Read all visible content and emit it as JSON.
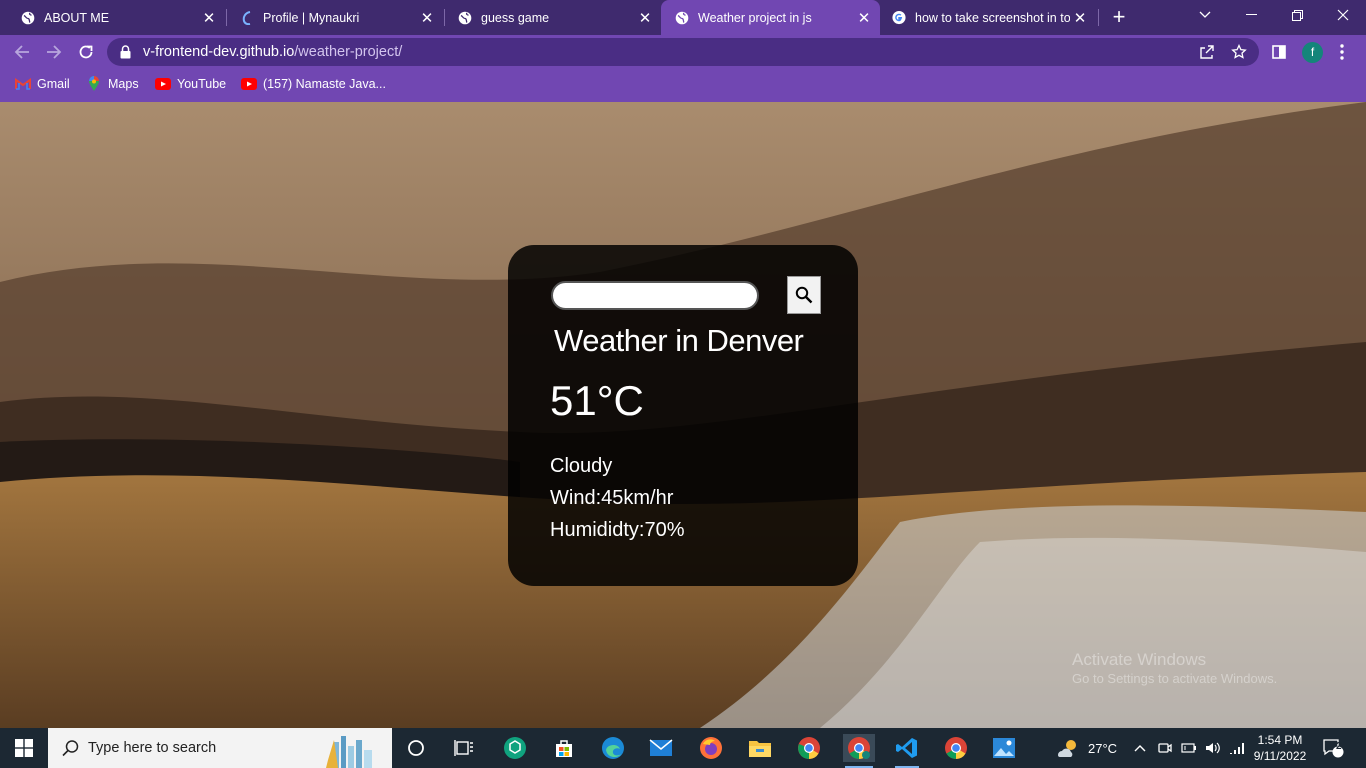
{
  "tabs": [
    {
      "title": "ABOUT ME",
      "icon": "globe-icon",
      "active": false
    },
    {
      "title": "Profile | Mynaukri",
      "icon": "naukri-icon",
      "active": false
    },
    {
      "title": "guess game",
      "icon": "globe-icon",
      "active": false
    },
    {
      "title": "Weather project in js",
      "icon": "globe-icon",
      "active": true
    },
    {
      "title": "how to take screenshot in to",
      "icon": "google-icon",
      "active": false
    }
  ],
  "address_bar": {
    "host": "v-frontend-dev.github.io",
    "path": "/weather-project/"
  },
  "profile_initial": "f",
  "bookmarks": [
    {
      "label": "Gmail",
      "icon": "gmail-icon"
    },
    {
      "label": "Maps",
      "icon": "maps-icon"
    },
    {
      "label": "YouTube",
      "icon": "youtube-icon"
    },
    {
      "label": "(157) Namaste Java...",
      "icon": "youtube-icon"
    }
  ],
  "weather": {
    "search_value": "",
    "city": "Weather in Denver",
    "temperature": "51°C",
    "description": "Cloudy",
    "wind": "Wind:45km/hr",
    "humidity": "Humididty:70%"
  },
  "watermark": {
    "line1": "Activate Windows",
    "line2": "Go to Settings to activate Windows."
  },
  "taskbar": {
    "search_placeholder": "Type here to search",
    "weather_temp": "27°C",
    "time": "1:54 PM",
    "date": "9/11/2022",
    "notification_count": "2"
  },
  "colors": {
    "tabstrip": "#3f2a6e",
    "toolbar": "#7147b2",
    "omnibox": "#4a2d84",
    "card": "#000000",
    "taskbar": "#1c2833"
  }
}
